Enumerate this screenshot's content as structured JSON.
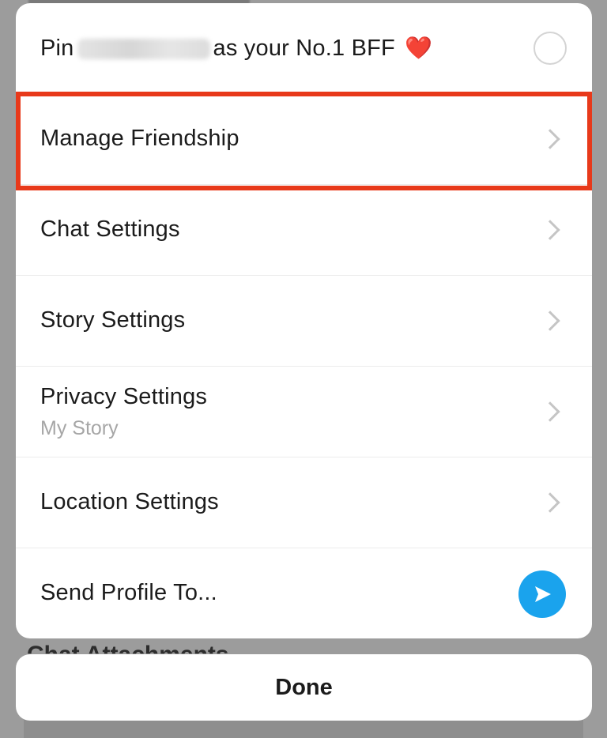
{
  "background": {
    "heading_partial": "Chat Attachments"
  },
  "menu": {
    "pin": {
      "prefix": "Pin",
      "suffix": "as your No.1 BFF",
      "heart": "❤️"
    },
    "items": [
      {
        "label": "Manage Friendship"
      },
      {
        "label": "Chat Settings"
      },
      {
        "label": "Story Settings"
      },
      {
        "label": "Privacy Settings",
        "sublabel": "My Story"
      },
      {
        "label": "Location Settings"
      }
    ],
    "send_profile": {
      "label": "Send Profile To..."
    }
  },
  "done_button": {
    "label": "Done"
  },
  "colors": {
    "highlight": "#e8391a",
    "send_button": "#1aa3ed",
    "heart": "#e0333a"
  },
  "icons": [
    "chevron-right-icon",
    "radio-circle-icon",
    "send-arrow-icon",
    "heart-icon"
  ]
}
